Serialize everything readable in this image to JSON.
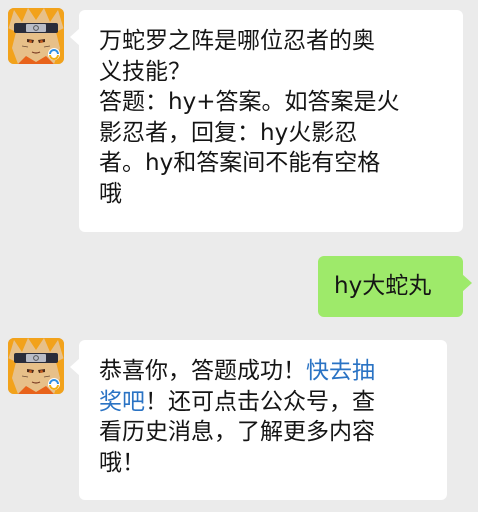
{
  "messages": [
    {
      "side": "left",
      "sender_avatar": "naruto-game-avatar",
      "lines": [
        "万蛇罗之阵是哪位忍者的奥",
        "义技能？",
        "答题：hy+答案。如答案是火",
        "影忍者，回复：hy火影忍",
        "者。hy和答案间不能有空格",
        "哦"
      ]
    },
    {
      "side": "right",
      "lines": [
        "hy大蛇丸"
      ]
    },
    {
      "side": "left",
      "sender_avatar": "naruto-game-avatar",
      "line1_prefix": "恭喜你，答题成功！",
      "line1_link": "快去抽",
      "line2_link": "奖吧",
      "line2_suffix": "！还可点击公众号，查",
      "line3": "看历史消息，了解更多内容",
      "line4": "哦！"
    }
  ],
  "colors": {
    "background": "#ebebeb",
    "incoming_bubble": "#ffffff",
    "outgoing_bubble": "#9eea6a",
    "link": "#2a73c4",
    "text": "#151515"
  }
}
